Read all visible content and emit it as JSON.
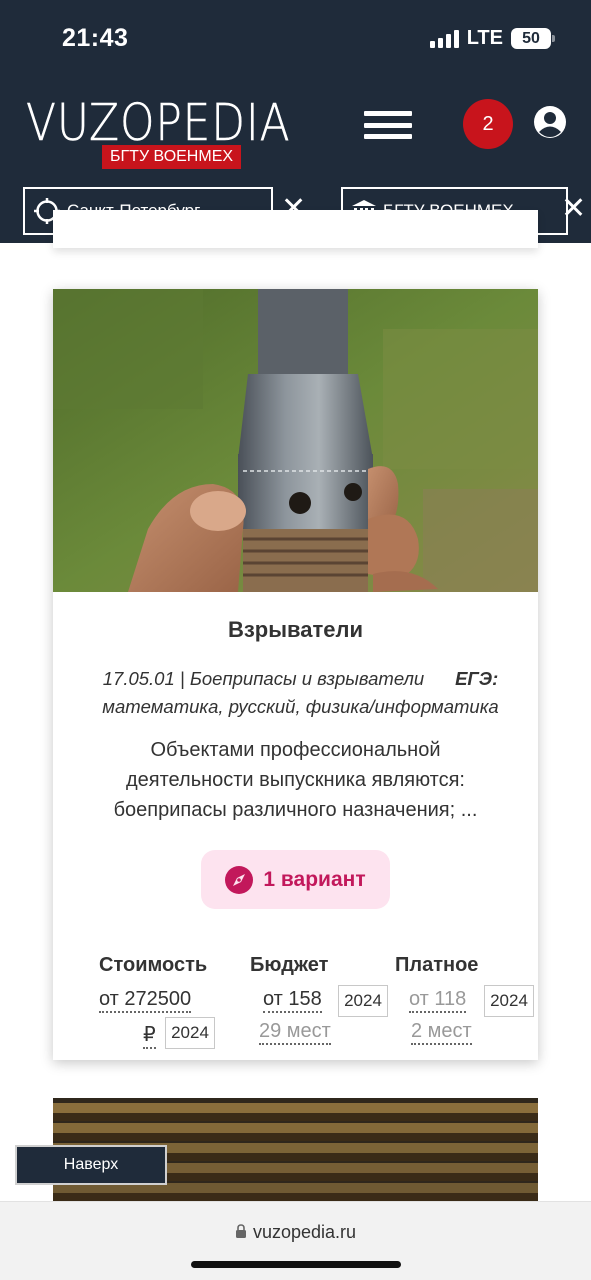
{
  "status": {
    "time": "21:43",
    "network": "LTE",
    "battery": "50"
  },
  "header": {
    "logo": "VUZOPEDIA",
    "logo_badge": "БГТУ ВОЕНМЕХ",
    "notifications_count": "2",
    "city_chip": "Санкт-Петербург",
    "uni_chip": "БГТУ ВОЕНМЕХ",
    "clear_symbol": "✕"
  },
  "card": {
    "title": "Взрыватели",
    "code_line": "17.05.01 | Боеприпасы и взрыватели",
    "ege_label": "ЕГЭ:",
    "ege_subjects": "математика, русский, физика/информатика",
    "description_1": "Объектами профессиональной",
    "description_2": "деятельности выпускника являются:",
    "description_3": "боеприпасы различного назначения; ...",
    "variant_label": "1 вариант",
    "stats": {
      "cost_header": "Стоимость",
      "cost_value": "от 272500",
      "cost_currency": "₽",
      "cost_year": "2024",
      "budget_header": "Бюджет",
      "budget_value": "от 158",
      "budget_year": "2024",
      "budget_places": "29 мест",
      "paid_header": "Платное",
      "paid_prefix": "от",
      "paid_value": "118",
      "paid_year": "2024",
      "paid_places": "2 мест"
    }
  },
  "to_top_button": "Наверх",
  "browser": {
    "url": "vuzopedia.ru"
  }
}
